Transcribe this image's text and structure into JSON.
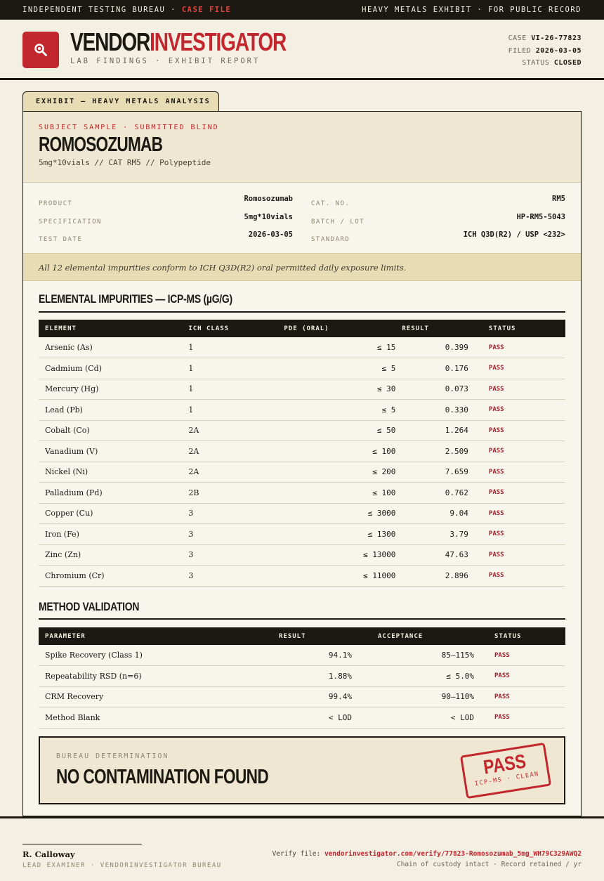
{
  "topbar": {
    "left_prefix": "INDEPENDENT TESTING BUREAU ·",
    "left_flag": "CASE FILE",
    "right": "HEAVY METALS EXHIBIT · FOR PUBLIC RECORD"
  },
  "header": {
    "brand_part1": "VENDOR",
    "brand_part2": "INVESTIGATOR",
    "subtitle": "LAB FINDINGS · EXHIBIT REPORT",
    "case_label": "CASE",
    "case_value": "VI-26-77823",
    "filed_label": "FILED",
    "filed_value": "2026-03-05",
    "status_label": "STATUS",
    "status_value": "CLOSED",
    "logo_icon": "magnifier-icon",
    "accent_color": "#c1272d"
  },
  "exhibit": {
    "tab_label": "EXHIBIT — HEAVY METALS ANALYSIS",
    "kicker": "SUBJECT SAMPLE · SUBMITTED BLIND",
    "sample_name": "ROMOSOZUMAB",
    "sample_sub": "5mg*10vials  //  CAT RM5  //  Polypeptide"
  },
  "details": {
    "product_label": "PRODUCT",
    "product_value": "Romosozumab",
    "spec_label": "SPECIFICATION",
    "spec_value": "5mg*10vials",
    "date_label": "TEST DATE",
    "date_value": "2026-03-05",
    "cat_label": "CAT. NO.",
    "cat_value": "RM5",
    "batch_label": "BATCH / LOT",
    "batch_value": "HP-RM5-5043",
    "standard_label": "STANDARD",
    "standard_value": "ICH Q3D(R2) / USP <232>"
  },
  "summary": "All 12 elemental impurities conform to ICH Q3D(R2) oral permitted daily exposure limits.",
  "impurities": {
    "title": "ELEMENTAL IMPURITIES — ICP-MS (µG/G)",
    "headers": [
      "ELEMENT",
      "ICH CLASS",
      "PDE (ORAL)",
      "RESULT",
      "STATUS"
    ],
    "rows": [
      {
        "element": "Arsenic (As)",
        "class": "1",
        "pde": "≤ 15",
        "result": "0.399",
        "status": "PASS"
      },
      {
        "element": "Cadmium (Cd)",
        "class": "1",
        "pde": "≤ 5",
        "result": "0.176",
        "status": "PASS"
      },
      {
        "element": "Mercury (Hg)",
        "class": "1",
        "pde": "≤ 30",
        "result": "0.073",
        "status": "PASS"
      },
      {
        "element": "Lead (Pb)",
        "class": "1",
        "pde": "≤ 5",
        "result": "0.330",
        "status": "PASS"
      },
      {
        "element": "Cobalt (Co)",
        "class": "2A",
        "pde": "≤ 50",
        "result": "1.264",
        "status": "PASS"
      },
      {
        "element": "Vanadium (V)",
        "class": "2A",
        "pde": "≤ 100",
        "result": "2.509",
        "status": "PASS"
      },
      {
        "element": "Nickel (Ni)",
        "class": "2A",
        "pde": "≤ 200",
        "result": "7.659",
        "status": "PASS"
      },
      {
        "element": "Palladium (Pd)",
        "class": "2B",
        "pde": "≤ 100",
        "result": "0.762",
        "status": "PASS"
      },
      {
        "element": "Copper (Cu)",
        "class": "3",
        "pde": "≤ 3000",
        "result": "9.04",
        "status": "PASS"
      },
      {
        "element": "Iron (Fe)",
        "class": "3",
        "pde": "≤ 1300",
        "result": "3.79",
        "status": "PASS"
      },
      {
        "element": "Zinc (Zn)",
        "class": "3",
        "pde": "≤ 13000",
        "result": "47.63",
        "status": "PASS"
      },
      {
        "element": "Chromium (Cr)",
        "class": "3",
        "pde": "≤ 11000",
        "result": "2.896",
        "status": "PASS"
      }
    ]
  },
  "validation": {
    "title": "METHOD VALIDATION",
    "headers": [
      "PARAMETER",
      "RESULT",
      "ACCEPTANCE",
      "STATUS"
    ],
    "rows": [
      {
        "parameter": "Spike Recovery (Class 1)",
        "result": "94.1%",
        "acceptance": "85–115%",
        "status": "PASS"
      },
      {
        "parameter": "Repeatability RSD (n=6)",
        "result": "1.88%",
        "acceptance": "≤ 5.0%",
        "status": "PASS"
      },
      {
        "parameter": "CRM Recovery",
        "result": "99.4%",
        "acceptance": "90–110%",
        "status": "PASS"
      },
      {
        "parameter": "Method Blank",
        "result": "< LOD",
        "acceptance": "< LOD",
        "status": "PASS"
      }
    ]
  },
  "determination": {
    "label": "BUREAU DETERMINATION",
    "verdict": "NO CONTAMINATION FOUND",
    "stamp_main": "PASS",
    "stamp_sub": "ICP-MS · CLEAN"
  },
  "footer": {
    "signer": "R. Calloway",
    "role": "LEAD EXAMINER · VENDORINVESTIGATOR BUREAU",
    "verify_label": "Verify file:",
    "verify_link": "vendorinvestigator.com/verify/77823-Romosozumab_5mg_WH79C329AWQ2",
    "custody": "Chain of custody intact · Record retained / yr"
  }
}
